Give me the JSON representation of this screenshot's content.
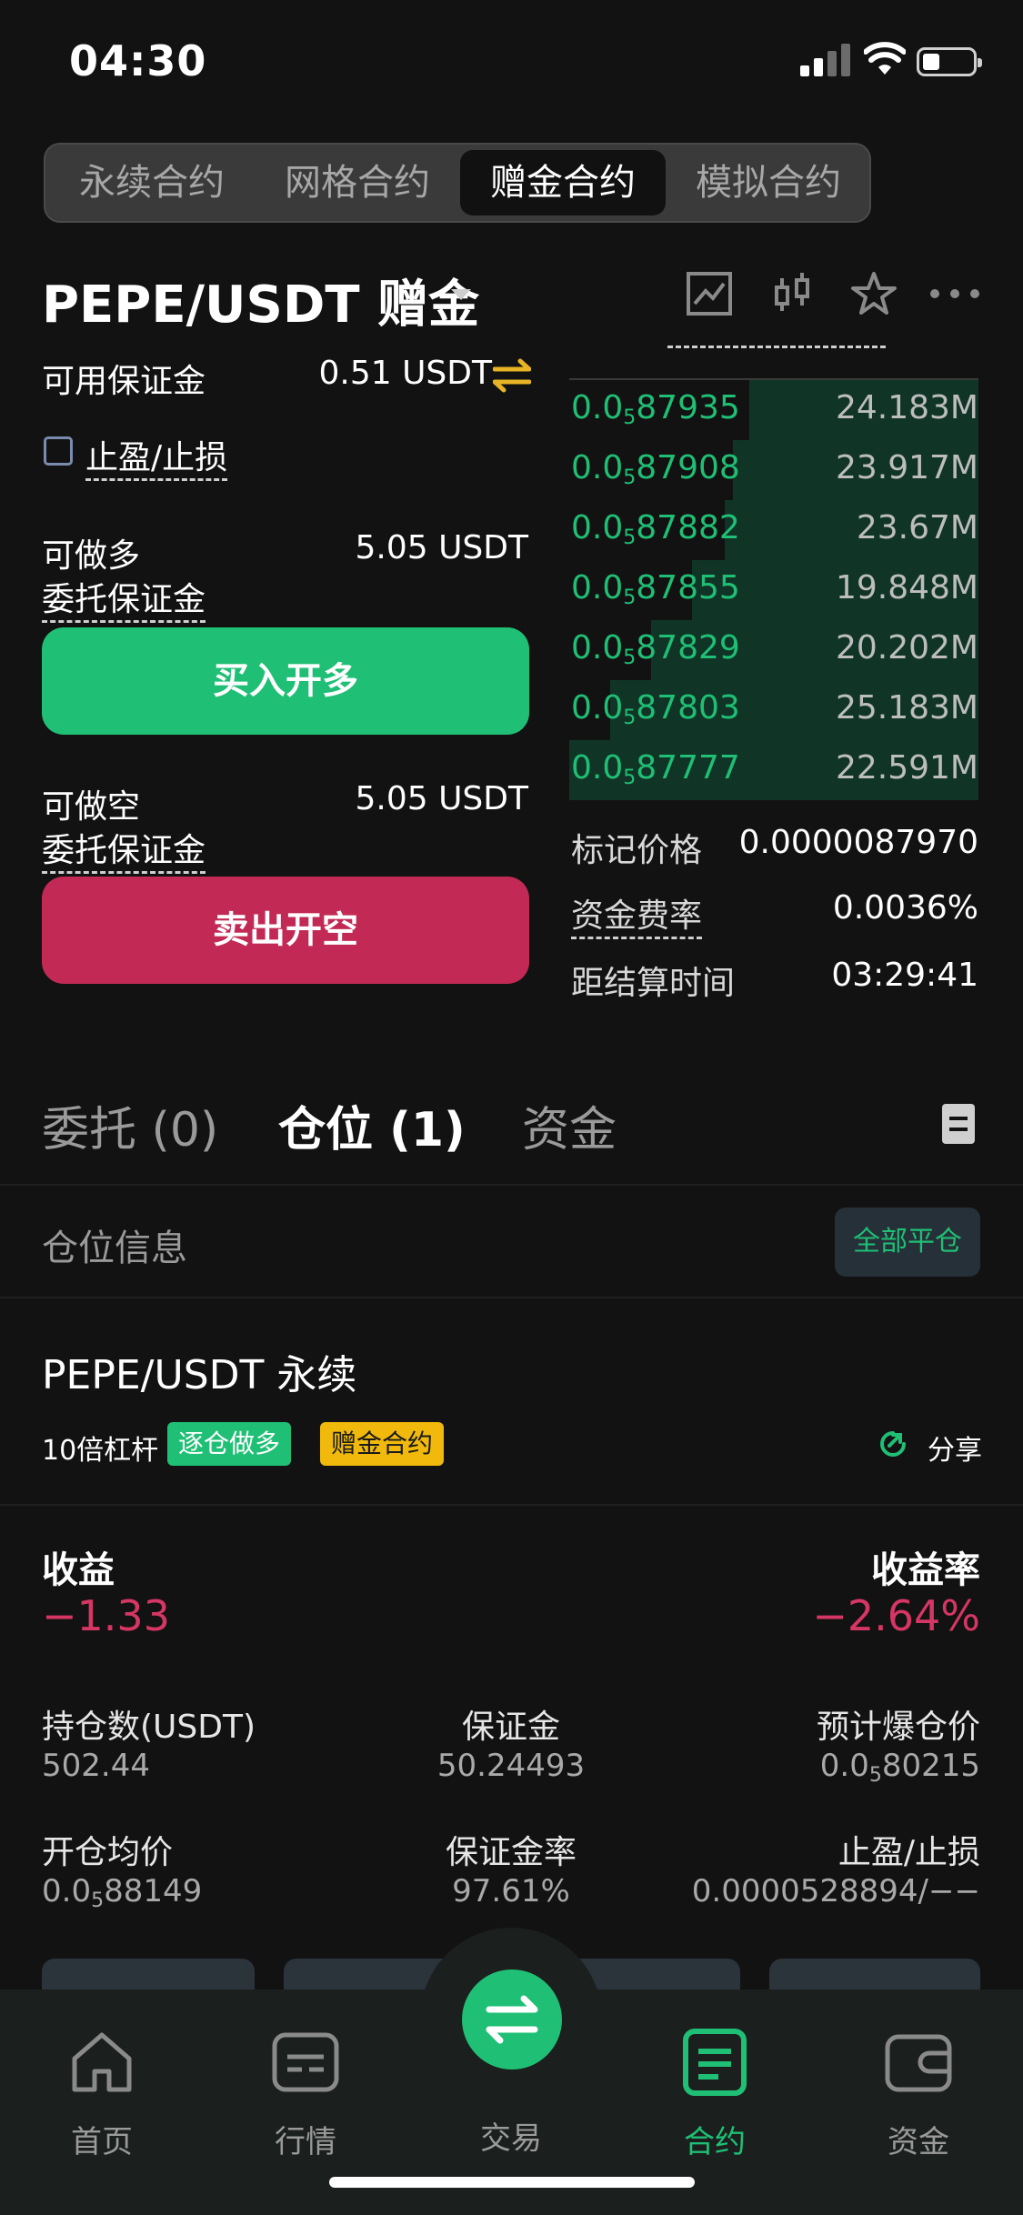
{
  "status_bar": {
    "time": "04:30"
  },
  "top_tabs": [
    "永续合约",
    "网格合约",
    "赠金合约",
    "模拟合约"
  ],
  "top_tabs_active": 2,
  "pair": {
    "title": "PEPE/USDT 赠金"
  },
  "left_panel": {
    "available_margin_label": "可用保证金",
    "available_margin_value": "0.51 USDT",
    "tp_sl_label": "止盈/止损",
    "long_label": "可做多",
    "long_value": "5.05 USDT",
    "long_margin_label": "委托保证金",
    "buy_button": "买入开多",
    "short_label": "可做空",
    "short_value": "5.05 USDT",
    "short_margin_label": "委托保证金",
    "sell_button": "卖出开空"
  },
  "order_book": {
    "rows": [
      {
        "prefix": "0.0",
        "sub": "5",
        "rest": "87935",
        "qty": "24.183M",
        "depth": 0.56
      },
      {
        "prefix": "0.0",
        "sub": "5",
        "rest": "87908",
        "qty": "23.917M",
        "depth": 0.6
      },
      {
        "prefix": "0.0",
        "sub": "5",
        "rest": "87882",
        "qty": "23.67M",
        "depth": 0.62
      },
      {
        "prefix": "0.0",
        "sub": "5",
        "rest": "87855",
        "qty": "19.848M",
        "depth": 0.7
      },
      {
        "prefix": "0.0",
        "sub": "5",
        "rest": "87829",
        "qty": "20.202M",
        "depth": 0.8
      },
      {
        "prefix": "0.0",
        "sub": "5",
        "rest": "87803",
        "qty": "25.183M",
        "depth": 0.9
      },
      {
        "prefix": "0.0",
        "sub": "5",
        "rest": "87777",
        "qty": "22.591M",
        "depth": 1.0
      }
    ],
    "mark_price_label": "标记价格",
    "mark_price_value": "0.0000087970",
    "funding_rate_label": "资金费率",
    "funding_rate_value": "0.0036%",
    "settlement_label": "距结算时间",
    "settlement_value": "03:29:41"
  },
  "position_tabs": [
    "委托 (0)",
    "仓位 (1)",
    "资金"
  ],
  "position_section": {
    "header": "仓位信息",
    "close_all": "全部平仓",
    "pair": "PEPE/USDT 永续",
    "leverage": "10倍杠杆",
    "badge_mode": "逐仓做多",
    "badge_bonus": "赠金合约",
    "share": "分享",
    "pnl_label": "收益",
    "pnl_value": "−1.33",
    "roe_label": "收益率",
    "roe_value": "−2.64%",
    "size_label": "持仓数(USDT)",
    "size_value": "502.44",
    "margin_label": "保证金",
    "margin_value": "50.24493",
    "liq_label": "预计爆仓价",
    "liq_prefix": "0.0",
    "liq_sub": "5",
    "liq_rest": "80215",
    "entry_label": "开仓均价",
    "entry_prefix": "0.0",
    "entry_sub": "5",
    "entry_rest": "88149",
    "margin_ratio_label": "保证金率",
    "margin_ratio_value": "97.61%",
    "tpsl_label": "止盈/止损",
    "tpsl_value": "0.0000528894/−−"
  },
  "bottom_nav": [
    "首页",
    "行情",
    "交易",
    "合约",
    "资金"
  ],
  "bottom_nav_active": 3
}
